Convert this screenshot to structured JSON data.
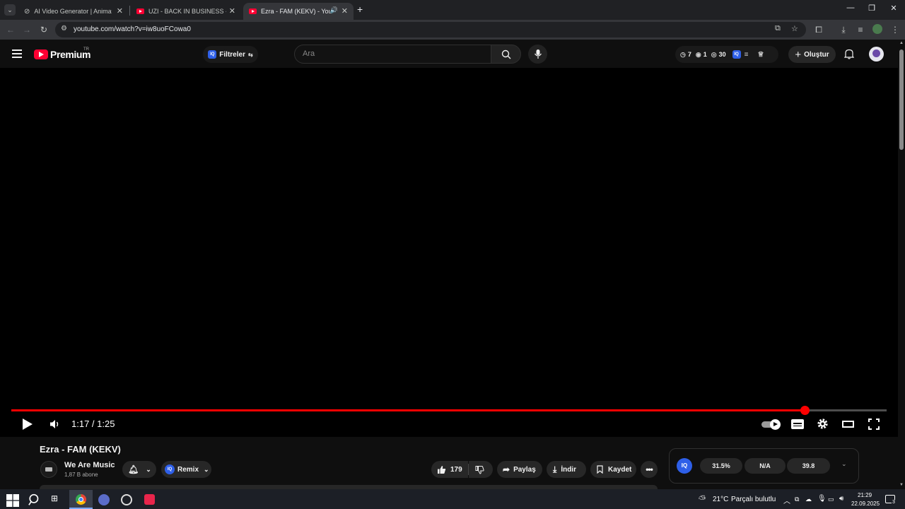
{
  "browser": {
    "tabs": [
      {
        "title": "AI Video Generator | Animate P",
        "active": false
      },
      {
        "title": "UZI - BACK IN BUSINESS - YouT",
        "active": false
      },
      {
        "title": "Ezra - FAM (KEKV) - YouTub",
        "active": true
      }
    ],
    "url": "youtube.com/watch?v=iw8uoFCowa0"
  },
  "youtube": {
    "logo_text": "Premium",
    "region": "TR",
    "filters_label": "Filtreler",
    "search_placeholder": "Ara",
    "stats": {
      "a": "7",
      "b": "1",
      "c": "30"
    },
    "create_label": "Oluştur"
  },
  "player": {
    "time": "1:17 / 1:25",
    "progress": 0.906
  },
  "video": {
    "title": "Ezra - FAM (KEKV)",
    "channel": "We Are Music",
    "subscribers": "1,87 B abone",
    "remix_label": "Remix",
    "likes": "179",
    "share_label": "Paylaş",
    "download_label": "İndir",
    "save_label": "Kaydet"
  },
  "iq_panel": {
    "stat1": "31.5%",
    "stat2": "N/A",
    "stat3": "39.8"
  },
  "taskbar": {
    "weather_temp": "21°C",
    "weather_text": "Parçalı bulutlu",
    "time": "21:29",
    "date": "22.09.2025",
    "notif_count": "3"
  },
  "colors": {
    "accent": "#ff0033",
    "progress": "#ff0000",
    "iq": "#2e5fe8"
  }
}
